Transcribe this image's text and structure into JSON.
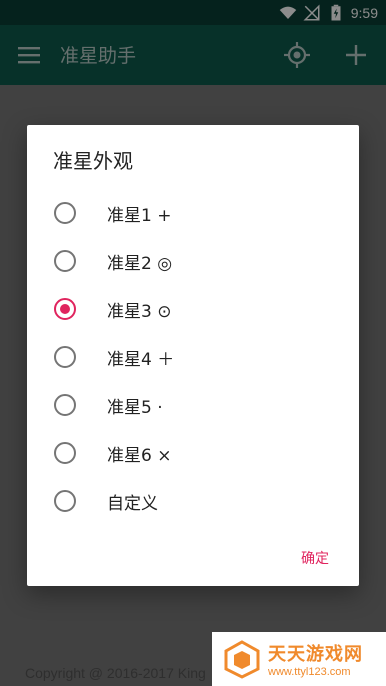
{
  "status_bar": {
    "time": "9:59",
    "icons": [
      "wifi-icon",
      "signal-off-icon",
      "battery-charging-icon"
    ]
  },
  "toolbar": {
    "title": "准星助手",
    "menu_icon": "menu-icon",
    "target_icon": "crosshair-target-icon",
    "add_icon": "plus-icon"
  },
  "dialog": {
    "title": "准星外观",
    "options": [
      {
        "label": "准星1 +",
        "checked": false
      },
      {
        "label": "准星2 ◎",
        "checked": false
      },
      {
        "label": "准星3 ⊙",
        "checked": true
      },
      {
        "label": "准星4 ＋",
        "checked": false
      },
      {
        "label": "准星5 ·",
        "checked": false
      },
      {
        "label": "准星6 ×",
        "checked": false
      },
      {
        "label": "自定义",
        "checked": false
      }
    ],
    "confirm_label": "确定",
    "accent_color": "#e0245e"
  },
  "background": {
    "copyright": "Copyright @ 2016-2017 King"
  },
  "watermark": {
    "title": "天天游戏网",
    "subtitle": "www.ttyl123.com"
  }
}
